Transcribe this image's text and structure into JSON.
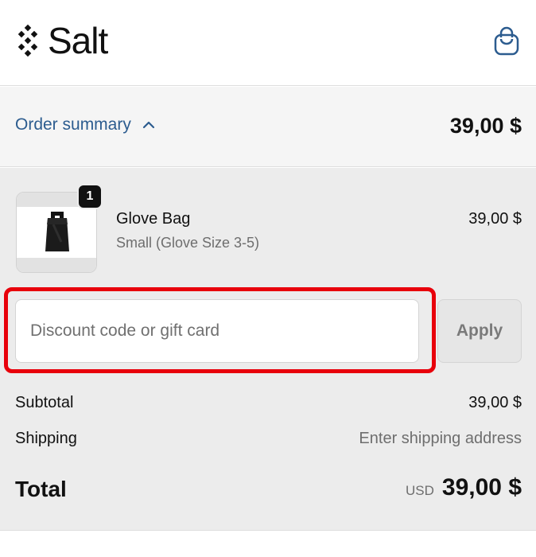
{
  "brand": {
    "name": "Salt"
  },
  "icons": {
    "logo": "diamond-dots-logo",
    "cart": "shopping-bag-icon",
    "toggle": "chevron-up-icon"
  },
  "colors": {
    "link": "#2c5c8f",
    "highlight": "#e8000b",
    "badge": "#111111"
  },
  "summary": {
    "label": "Order summary",
    "total": "39,00 $"
  },
  "item": {
    "quantity": "1",
    "name": "Glove Bag",
    "variant": "Small (Glove Size 3-5)",
    "price": "39,00 $"
  },
  "discount": {
    "placeholder": "Discount code or gift card",
    "value": "",
    "apply_label": "Apply"
  },
  "totals": {
    "subtotal_label": "Subtotal",
    "subtotal_value": "39,00 $",
    "shipping_label": "Shipping",
    "shipping_value": "Enter shipping address",
    "total_label": "Total",
    "currency": "USD",
    "total_value": "39,00 $"
  }
}
